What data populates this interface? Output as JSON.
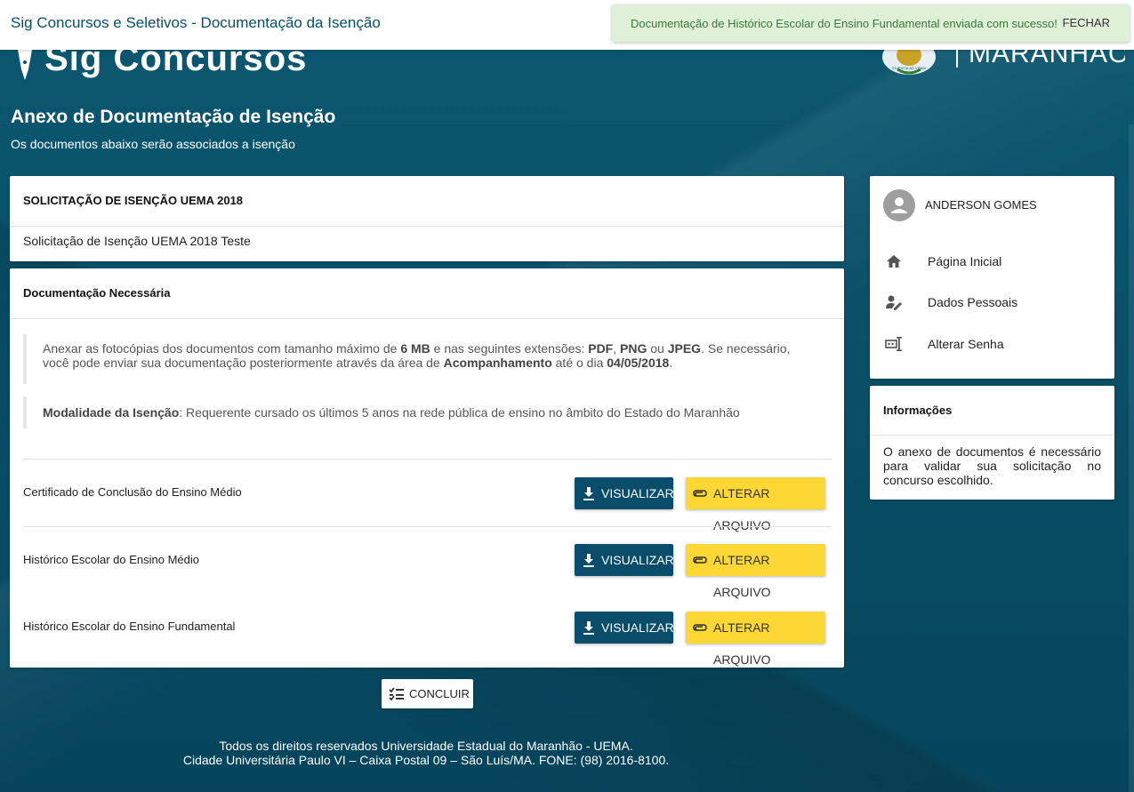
{
  "topbar": {
    "title": "Sig Concursos e Seletivos - Documentação da Isenção"
  },
  "toast": {
    "message": "Documentação de Histórico Escolar do Ensino Fundamental enviada com sucesso!",
    "close_label": "FECHAR"
  },
  "header": {
    "logo_text": "Sig Concursos",
    "right_logo_text": "MARANHÃO",
    "seal_text": "SCIENTIA AD VITAM"
  },
  "page": {
    "title": "Anexo de Documentação de Isenção",
    "subtitle": "Os documentos abaixo serão associados a isenção"
  },
  "solicitacao": {
    "heading": "SOLICITAÇÃO DE ISENÇÃO UEMA 2018",
    "description": "Solicitação de Isenção UEMA 2018 Teste"
  },
  "documentacao": {
    "heading": "Documentação Necessária",
    "note1": {
      "t1": "Anexar as fotocópias dos documentos com tamanho máximo de ",
      "b1": "6 MB",
      "t2": " e nas seguintes extensões: ",
      "b2": "PDF",
      "t3": ", ",
      "b3": "PNG",
      "t4": " ou ",
      "b4": "JPEG",
      "t5": ". Se necessário, você pode enviar sua documentação posteriormente através da área de ",
      "b5": "Acompanhamento",
      "t6": " até o dia ",
      "b6": "04/05/2018",
      "t7": "."
    },
    "note2": {
      "label": "Modalidade da Isenção",
      "text": ": Requerente cursado os últimos 5 anos na rede pública de ensino no âmbito do Estado do Maranhão"
    },
    "documents": [
      {
        "label": "Certificado de Conclusão do Ensino Médio",
        "view_label": "VISUALIZAR",
        "alter_label": "ALTERAR ARQUIVO"
      },
      {
        "label": "Histórico Escolar do Ensino Médio",
        "view_label": "VISUALIZAR",
        "alter_label": "ALTERAR ARQUIVO"
      },
      {
        "label": "Histórico Escolar do Ensino Fundamental",
        "view_label": "VISUALIZAR",
        "alter_label": "ALTERAR ARQUIVO"
      }
    ]
  },
  "concluir_label": "CONCLUIR",
  "footer": {
    "line1": "Todos os direitos reservados Universidade Estadual do Maranhão - UEMA.",
    "line2": "Cidade Universitária Paulo VI – Caixa Postal 09 – São Luís/MA. FONE: (98) 2016-8100."
  },
  "sidebar": {
    "user_name": "ANDERSON GOMES",
    "items": [
      {
        "label": "Página Inicial",
        "icon": "home-icon"
      },
      {
        "label": "Dados Pessoais",
        "icon": "person-edit-icon"
      },
      {
        "label": "Alterar Senha",
        "icon": "password-icon"
      }
    ]
  },
  "informacoes": {
    "heading": "Informações",
    "text": "O anexo de documentos é necessário para validar sua solicitação no concurso escolhido."
  },
  "colors": {
    "primary": "#0a4d6b",
    "accent": "#fdd835",
    "success_bg": "#dff0d8",
    "success_text": "#3c763d"
  }
}
